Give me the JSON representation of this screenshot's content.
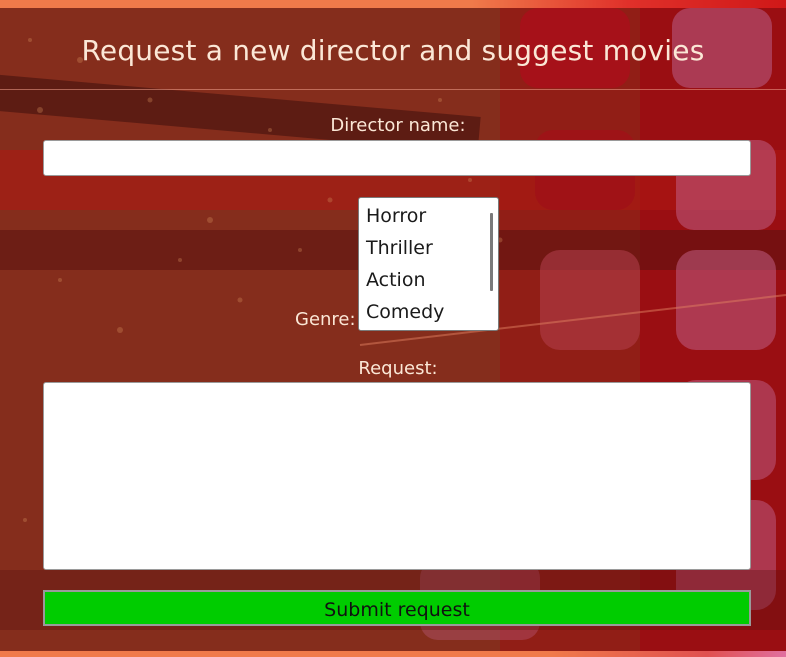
{
  "page": {
    "title": "Request a new director and suggest movies"
  },
  "form": {
    "director_label": "Director name:",
    "director_value": "",
    "genre_label": "Genre:",
    "genre_options": [
      "Horror",
      "Thriller",
      "Action",
      "Comedy"
    ],
    "request_label": "Request:",
    "request_value": "",
    "submit_label": "Submit request"
  },
  "colors": {
    "submit_background": "#00cc00",
    "text_light": "#fbe7d6",
    "background_base": "#7a2a1c"
  }
}
